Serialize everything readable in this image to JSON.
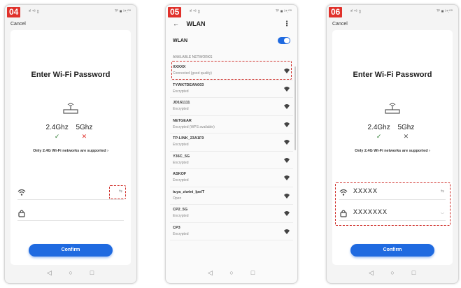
{
  "phones": [
    {
      "step": "04",
      "status_left": "ᵃˡ ⁴⁶ ▯",
      "status_right": "ᵀᴾ ■ ¹⁴:⁰⁰",
      "cancel": "Cancel",
      "title": "Enter Wi-Fi Password",
      "band_24_label": "2.4Ghz",
      "band_24_mark": "✓",
      "band_5_label": "5Ghz",
      "band_5_mark": "✕",
      "band_note": "Only 2.4G Wi-Fi networks are supported ›",
      "wifi_value": "",
      "wifi_right": "⇆",
      "password_value": "",
      "password_right": "",
      "confirm": "Confirm",
      "nav": [
        "◁",
        "○",
        "□"
      ]
    },
    {
      "step": "05",
      "status_left": "ᵃˡ ⁴⁶ ▯",
      "status_right": "ᵀᴾ ■ ¹⁴:⁰⁰",
      "header_back": "←",
      "header_title": "WLAN",
      "header_more": "⋮",
      "toggle_label": "WLAN",
      "section": "AVAILABLE NETWORKS",
      "networks": [
        {
          "name": "XXXXX",
          "status": "Connected (good quality)"
        },
        {
          "name": "TYWKTDEAN003",
          "status": "Encrypted"
        },
        {
          "name": "JD161111",
          "status": "Encrypted"
        },
        {
          "name": "NETGEAR",
          "status": "Encrypted (WPS available)"
        },
        {
          "name": "TP-LINK_23A1F9",
          "status": "Encrypted"
        },
        {
          "name": "Y36C_5G",
          "status": "Encrypted"
        },
        {
          "name": "ASKOF",
          "status": "Encrypted"
        },
        {
          "name": "tuya_ziwini_IpelT",
          "status": "Open"
        },
        {
          "name": "CP2_5G",
          "status": "Encrypted"
        },
        {
          "name": "CP3",
          "status": "Encrypted"
        }
      ],
      "nav": [
        "◁",
        "○",
        "□"
      ]
    },
    {
      "step": "06",
      "status_left": "ᵃˡ ⁴⁶ ▯",
      "status_right": "ᵀᴾ ■ ¹⁴:⁰⁰",
      "cancel": "Cancel",
      "title": "Enter Wi-Fi Password",
      "band_24_label": "2.4Ghz",
      "band_24_mark": "✓",
      "band_5_label": "5Ghz",
      "band_5_mark": "✕",
      "band_note": "Only 2.4G Wi-Fi networks are supported ›",
      "wifi_value": "XXXXX",
      "wifi_right": "⇆",
      "password_value": "XXXXXXX",
      "password_right": "◡",
      "confirm": "Confirm",
      "nav": [
        "◁",
        "○",
        "□"
      ]
    }
  ],
  "colors": {
    "badge": "#e0312b",
    "accent": "#1f6ae0",
    "highlight": "#d0302b",
    "check": "#2f7d32"
  }
}
